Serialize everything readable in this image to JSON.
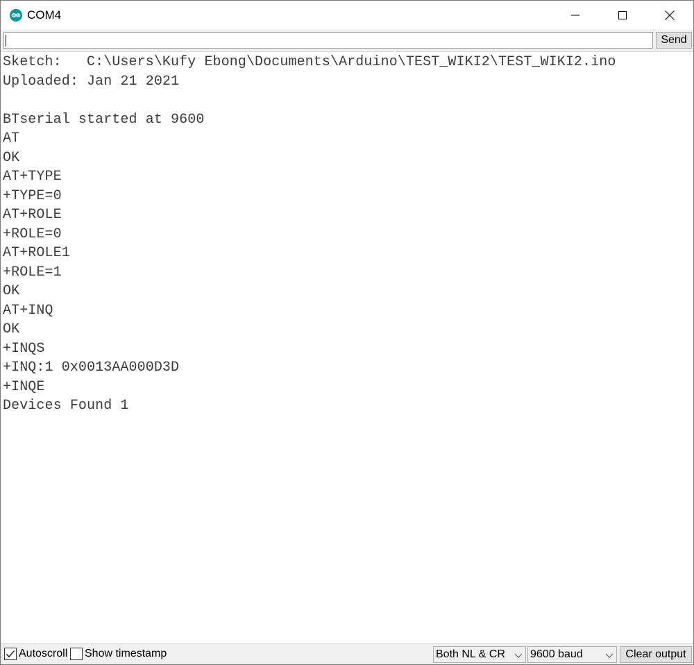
{
  "window": {
    "title": "COM4",
    "accent_color": "#00979c"
  },
  "icons": {
    "app": "arduino-logo-icon",
    "minimize": "minimize-icon",
    "maximize": "maximize-icon",
    "close": "close-icon",
    "checkmark": "checkmark-icon",
    "dropdown": "chevron-down-icon"
  },
  "send_row": {
    "input_value": "",
    "send_label": "Send"
  },
  "output": {
    "lines": [
      "Sketch:   C:\\Users\\Kufy Ebong\\Documents\\Arduino\\TEST_WIKI2\\TEST_WIKI2.ino",
      "Uploaded: Jan 21 2021",
      "",
      "BTserial started at 9600",
      "AT",
      "OK",
      "AT+TYPE",
      "+TYPE=0",
      "AT+ROLE",
      "+ROLE=0",
      "AT+ROLE1",
      "+ROLE=1",
      "OK",
      "AT+INQ",
      "OK",
      "+INQS",
      "+INQ:1 0x0013AA000D3D",
      "+INQE",
      "Devices Found 1"
    ]
  },
  "bottom_bar": {
    "autoscroll_label": "Autoscroll",
    "autoscroll_checked": true,
    "timestamp_label": "Show timestamp",
    "timestamp_checked": false,
    "line_ending_value": "Both NL & CR",
    "baud_value": "9600 baud",
    "clear_label": "Clear output"
  }
}
